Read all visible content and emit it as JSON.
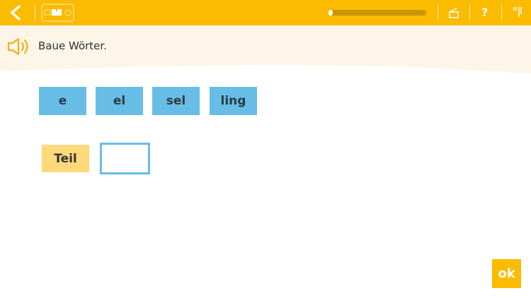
{
  "topbar": {
    "help_label": "?",
    "progress": 0.02
  },
  "header": {
    "instruction": "Baue Wörter."
  },
  "syllables": [
    "e",
    "el",
    "sel",
    "ling"
  ],
  "word_start": "Teil",
  "drop_slot": "",
  "ok_label": "ok",
  "colors": {
    "brand": "#fbbb00",
    "tile": "#67bde6",
    "word": "#ffd97a"
  }
}
